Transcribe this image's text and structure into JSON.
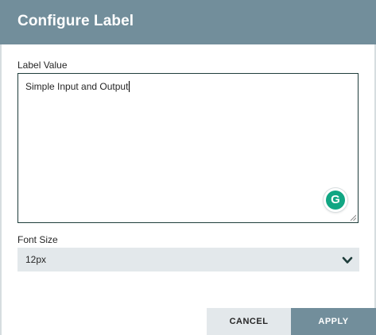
{
  "dialog": {
    "title": "Configure Label"
  },
  "label_value": {
    "label": "Label Value",
    "value": "Simple Input and Output"
  },
  "font_size": {
    "label": "Font Size",
    "selected": "12px"
  },
  "buttons": {
    "cancel": "CANCEL",
    "apply": "APPLY"
  },
  "icons": {
    "grammarly": "grammarly-icon",
    "grammarly_glyph": "G",
    "dropdown": "chevron-down-icon",
    "resize": "resize-grip-icon"
  },
  "colors": {
    "header": "#728e9b",
    "field_background": "#e3e8eb",
    "textarea_border": "#1f3d3b",
    "grammarly": "#11a683"
  }
}
